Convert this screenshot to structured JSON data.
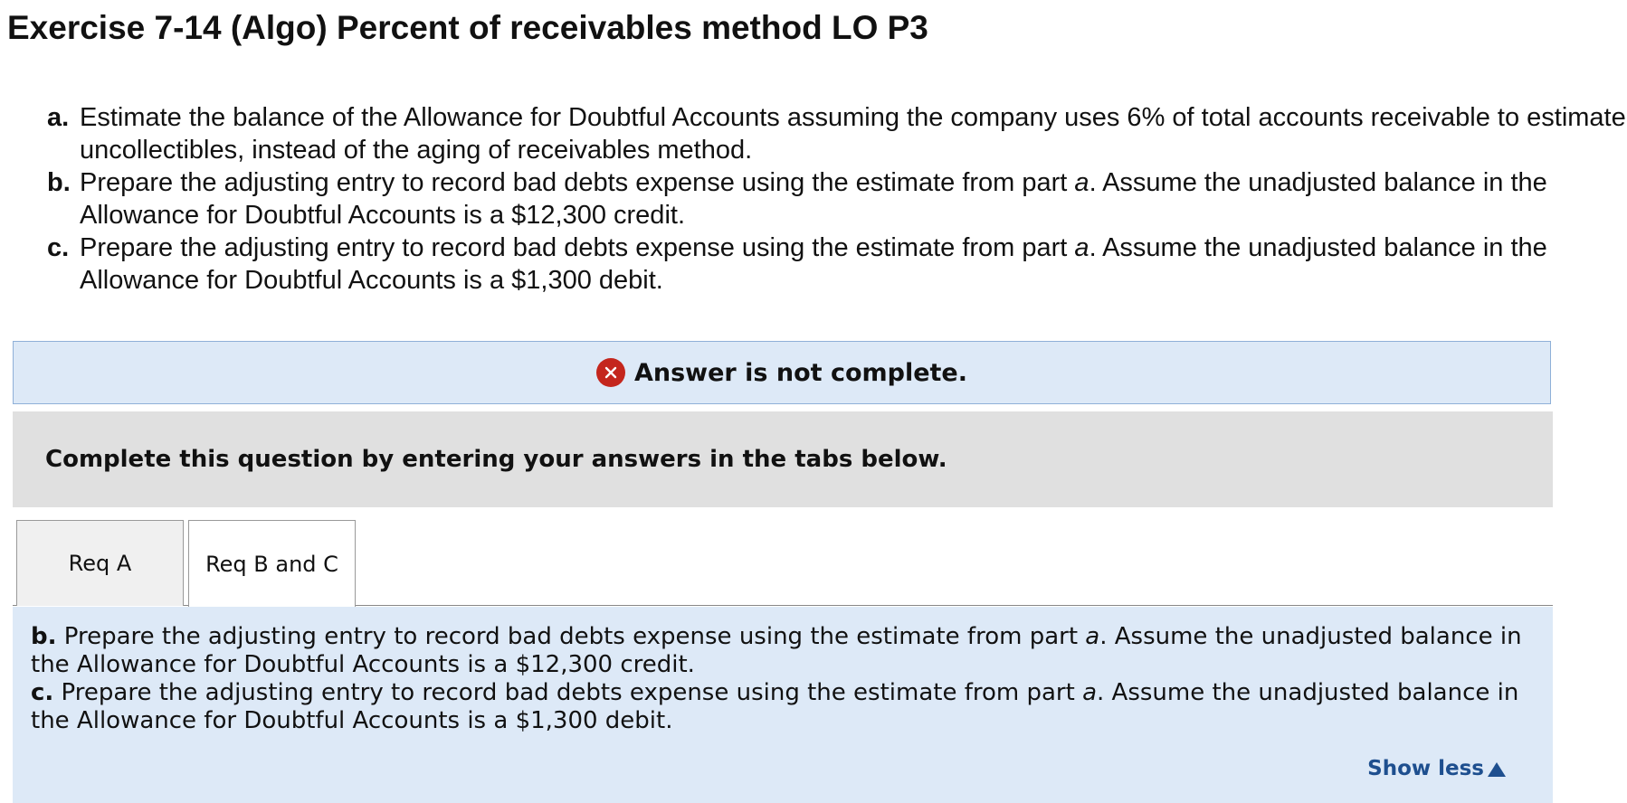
{
  "page": {
    "title": "Exercise 7-14 (Algo) Percent of receivables method LO P3"
  },
  "instructions": [
    {
      "letter": "a.",
      "part1": "Estimate the balance of the Allowance for Doubtful Accounts assuming the company uses 6% of total accounts receivable to estimate uncollectibles, instead of the aging of receivables method.",
      "italic": "",
      "part2": ""
    },
    {
      "letter": "b.",
      "part1": "Prepare the adjusting entry to record bad debts expense using the estimate from part ",
      "italic": "a",
      "part2": ". Assume the unadjusted balance in the Allowance for Doubtful Accounts is a $12,300 credit."
    },
    {
      "letter": "c.",
      "part1": "Prepare the adjusting entry to record bad debts expense using the estimate from part ",
      "italic": "a",
      "part2": ". Assume the unadjusted balance in the Allowance for Doubtful Accounts is a $1,300 debit."
    }
  ],
  "alert": {
    "icon": "error-x-icon",
    "text": "Answer is not complete.",
    "color": "#c4261d"
  },
  "instruction_bar": {
    "text": "Complete this question by entering your answers in the tabs below."
  },
  "tabs": [
    {
      "label": "Req A",
      "active": false
    },
    {
      "label": "Req B and C",
      "active": true
    }
  ],
  "panel": {
    "b": {
      "letter": "b.",
      "part1": " Prepare the adjusting entry to record bad debts expense using the estimate from part ",
      "italic": "a",
      "part2": ". Assume the unadjusted balance in the Allowance for Doubtful Accounts is a $12,300 credit."
    },
    "c": {
      "letter": "c.",
      "part1": " Prepare the adjusting entry to record bad debts expense using the estimate from part ",
      "italic": "a",
      "part2": ". Assume the unadjusted balance in the Allowance for Doubtful Accounts is a $1,300 debit."
    },
    "show_less_label": "Show less"
  },
  "colors": {
    "alert_bg": "#dde9f7",
    "link": "#1e4f8f",
    "instruction_bar_bg": "#e0e0e0"
  }
}
